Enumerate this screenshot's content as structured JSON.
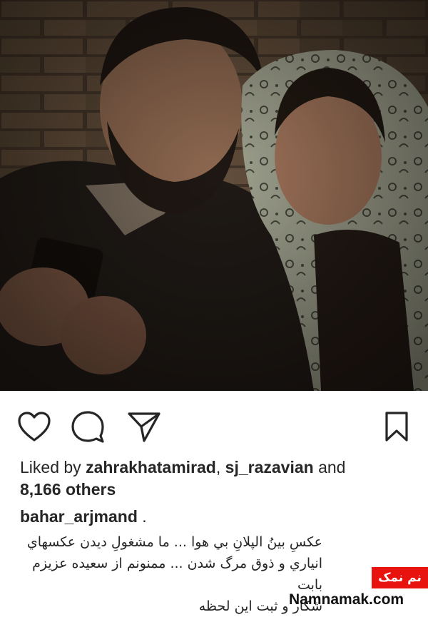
{
  "post": {
    "photo": {
      "alt": "Photo of a bearded man looking at his phone with a smiling woman in a patterned headscarf leaning on his shoulder"
    },
    "actions": {
      "like_icon": "heart-icon",
      "comment_icon": "comment-bubble-icon",
      "share_icon": "paper-plane-icon",
      "save_icon": "bookmark-icon"
    },
    "likes": {
      "prefix": "Liked by ",
      "user1": "zahrakhatamirad",
      "separator": ", ",
      "user2": "sj_razavian",
      "and_text": " and",
      "others_count": "8,166 others"
    },
    "username": "bahar_arjmand",
    "username_suffix": " .",
    "caption_lines": [
      "عكسِ بينُ الپلانِ بي هوا ... ما مشغولِ ديدن عكسهاي",
      "انياري و ذوق مرگ شدن ... ممنونم از سعيده عزيزم بابت",
      "شكار و ثبت اين لحظه"
    ]
  },
  "watermark": {
    "badge": "نم نمک",
    "site": "Namnamak.com"
  },
  "colors": {
    "text": "#262626",
    "watermark_red": "#e8120e",
    "icon": "#262626"
  }
}
